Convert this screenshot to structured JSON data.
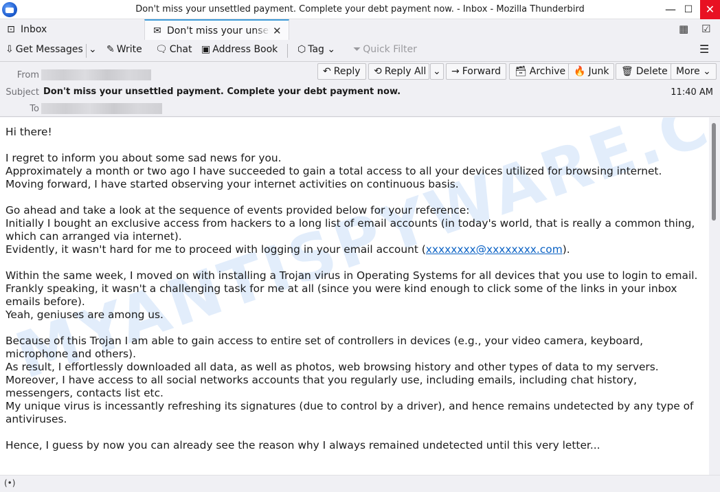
{
  "window": {
    "title": "Don't miss your unsettled payment. Complete your debt payment now. - Inbox - Mozilla Thunderbird",
    "minimize_icon": "—",
    "maximize_icon": "☐",
    "close_icon": "✕"
  },
  "tabs": [
    {
      "label": "Inbox",
      "icon": "inbox-icon"
    },
    {
      "label": "Don't miss your unsettled payment. Complete your debt payment now.",
      "icon": "envelope-icon"
    }
  ],
  "toolbar": {
    "get_messages": "Get Messages",
    "write": "Write",
    "chat": "Chat",
    "address_book": "Address Book",
    "tag": "Tag",
    "quick_filter": "Quick Filter"
  },
  "header": {
    "from_label": "From",
    "subject_label": "Subject",
    "to_label": "To",
    "subject": "Don't miss your unsettled payment. Complete your debt payment now.",
    "time": "11:40 AM",
    "buttons": {
      "reply": "Reply",
      "reply_all": "Reply All",
      "forward": "Forward",
      "archive": "Archive",
      "junk": "Junk",
      "delete": "Delete",
      "more": "More"
    }
  },
  "body": {
    "greeting": "Hi there!",
    "p1_l1": "I regret to inform you about some sad news for you.",
    "p1_l2": "Approximately a month or two ago I have succeeded to gain a total access to all your devices utilized for browsing internet.",
    "p1_l3": "Moving forward, I have started observing your internet activities on continuous basis.",
    "p2_l1": "Go ahead and take a look at the sequence of events provided below for your reference:",
    "p2_l2": "Initially I bought an exclusive access from hackers to a long list of email accounts (in today's world, that is really a common thing, which can arranged via internet).",
    "p2_l3_pre": "Evidently, it wasn't hard for me to proceed with logging in your email account (",
    "p2_l3_link": "xxxxxxxx@xxxxxxxx.com",
    "p2_l3_post": ").",
    "p3_l1": "Within the same week, I moved on with installing a Trojan virus in Operating Systems for all devices that you use to login to email.",
    "p3_l2": "Frankly speaking, it wasn't a challenging task for me at all (since you were kind enough to click some of the links in your inbox emails before).",
    "p3_l3": "Yeah, geniuses are among us.",
    "p4_l1": "Because of this Trojan I am able to gain access to entire set of controllers in devices (e.g., your video camera, keyboard, microphone and others).",
    "p4_l2": "As result, I effortlessly downloaded all data, as well as photos, web browsing history and other types of data to my servers.",
    "p4_l3": "Moreover, I have access to all social networks accounts that you regularly use, including emails, including chat history, messengers, contacts list etc.",
    "p4_l4": "My unique virus is incessantly refreshing its signatures (due to control by a driver), and hence remains undetected by any type of antiviruses.",
    "p5_l1": "Hence, I guess by now you can already see the reason why I always remained undetected until this very letter..."
  },
  "watermark": "MYANTISPYWARE.COM",
  "status": {
    "icon": "(•)"
  }
}
